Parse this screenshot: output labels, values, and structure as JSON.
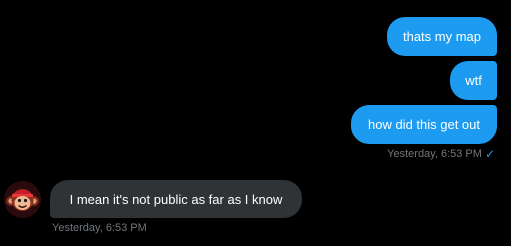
{
  "conversation": {
    "sent_messages": [
      {
        "text": "thats my map"
      },
      {
        "text": "wtf"
      },
      {
        "text": "how did this get out"
      }
    ],
    "sent_timestamp": "Yesterday, 6:53 PM",
    "read_status_icon": "checkmark-icon",
    "received_messages": [
      {
        "text": "I mean it's not public as far as I know"
      }
    ],
    "received_timestamp": "Yesterday, 6:53 PM",
    "received_avatar_icon": "monkey-avatar-icon"
  },
  "colors": {
    "background": "#000000",
    "sent_bubble": "#1d9bf0",
    "received_bubble": "#2f3336",
    "meta_text": "#71767b"
  }
}
